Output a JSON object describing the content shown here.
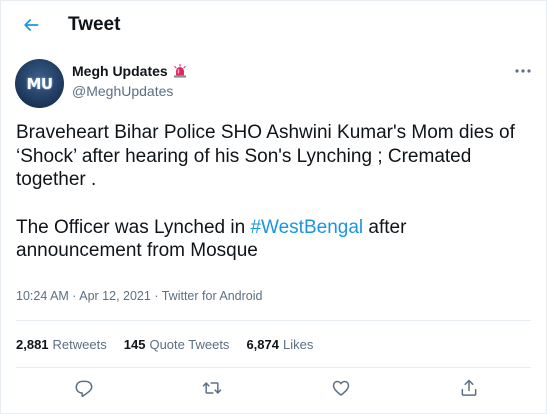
{
  "header": {
    "back_icon": "arrow-left-icon",
    "title": "Tweet"
  },
  "author": {
    "avatar_text": "MU",
    "name": "Megh Updates",
    "badge_icon": "police-light-emoji",
    "handle": "@MeghUpdates",
    "more_icon": "more-horizontal-icon"
  },
  "tweet": {
    "line1": "Braveheart Bihar Police SHO Ashwini Kumar's Mom dies of ‘Shock’ after hearing of his Son's Lynching ; Cremated together .",
    "line2_before": "The Officer was Lynched in ",
    "hashtag": "#WestBengal",
    "line2_after": " after announcement from Mosque"
  },
  "meta": {
    "time": "10:24 AM",
    "sep1": " · ",
    "date": "Apr 12, 2021",
    "sep2": " · ",
    "source": "Twitter for Android"
  },
  "stats": {
    "retweets_count": "2,881",
    "retweets_label": "Retweets",
    "quotes_count": "145",
    "quotes_label": "Quote Tweets",
    "likes_count": "6,874",
    "likes_label": "Likes"
  },
  "actions": {
    "reply_icon": "reply-icon",
    "retweet_icon": "retweet-icon",
    "like_icon": "heart-icon",
    "share_icon": "share-icon"
  },
  "colors": {
    "accent": "#1b95e0",
    "text": "#0f1419",
    "secondary": "#5b7083",
    "border": "#e6ecf0"
  }
}
